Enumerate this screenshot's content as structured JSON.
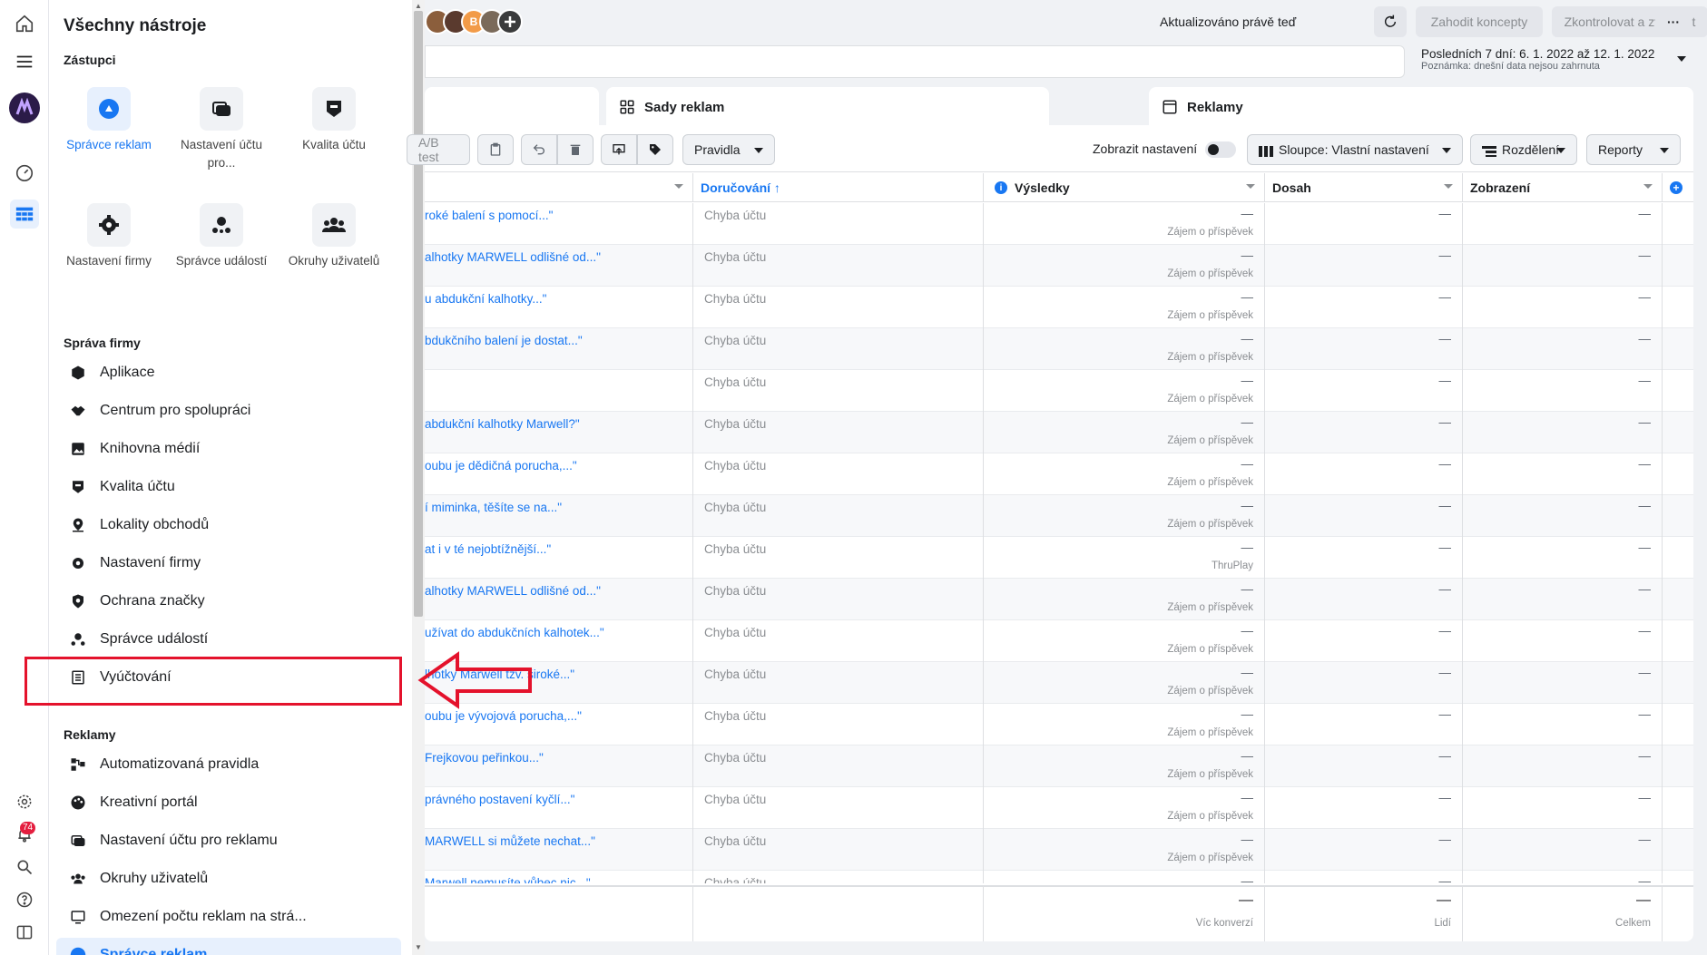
{
  "panel": {
    "title": "Všechny nástroje",
    "shortcuts_label": "Zástupci",
    "shortcuts": [
      {
        "label": "Správce reklam",
        "icon": "ads-manager-icon"
      },
      {
        "label": "Nastavení účtu pro...",
        "icon": "ad-account-settings-icon"
      },
      {
        "label": "Kvalita účtu",
        "icon": "account-quality-icon"
      },
      {
        "label": "Nastavení firmy",
        "icon": "gear-icon"
      },
      {
        "label": "Správce událostí",
        "icon": "events-manager-icon"
      },
      {
        "label": "Okruhy uživatelů",
        "icon": "audiences-icon"
      }
    ],
    "business_label": "Správa firmy",
    "business_items": [
      "Aplikace",
      "Centrum pro spolupráci",
      "Knihovna médií",
      "Kvalita účtu",
      "Lokality obchodů",
      "Nastavení firmy",
      "Ochrana značky",
      "Správce událostí",
      "Vyúčtování"
    ],
    "ads_label": "Reklamy",
    "ads_items": [
      "Automatizovaná pravidla",
      "Kreativní portál",
      "Nastavení účtu pro reklamu",
      "Okruhy uživatelů",
      "Omezení počtu reklam na strá...",
      "Správce reklam"
    ]
  },
  "rail": {
    "notification_count": "74"
  },
  "topbar": {
    "updated": "Aktualizováno právě teď",
    "discard": "Zahodit koncepty",
    "review": "Zkontrolovat a zveřejnit",
    "more": "···",
    "avatar_letter": "B"
  },
  "date": {
    "range": "Posledních 7 dní: 6. 1. 2022 až 12. 1. 2022",
    "note": "Poznámka: dnešní data nejsou zahrnuta"
  },
  "tabs": {
    "adsets": "Sady reklam",
    "ads": "Reklamy"
  },
  "toolbar": {
    "test": "A/B test",
    "rules": "Pravidla",
    "show_settings": "Zobrazit nastavení",
    "columns": "Sloupce: Vlastní nastavení",
    "breakdown": "Rozdělení",
    "reports": "Reporty"
  },
  "table": {
    "headers": {
      "delivery": "Doručování ↑",
      "results": "Výsledky",
      "reach": "Dosah",
      "impressions": "Zobrazení"
    },
    "rows": [
      {
        "name": "roké balení s pomocí...\"",
        "delivery": "Chyba účtu",
        "result": "—",
        "result_type": "Zájem o příspěvek",
        "reach": "—",
        "impressions": "—"
      },
      {
        "name": "alhotky MARWELL odlišné od...\"",
        "delivery": "Chyba účtu",
        "result": "—",
        "result_type": "Zájem o příspěvek",
        "reach": "—",
        "impressions": "—"
      },
      {
        "name": "u abdukční kalhotky...\"",
        "delivery": "Chyba účtu",
        "result": "—",
        "result_type": "Zájem o příspěvek",
        "reach": "—",
        "impressions": "—"
      },
      {
        "name": "bdukčního balení je dostat...\"",
        "delivery": "Chyba účtu",
        "result": "—",
        "result_type": "Zájem o příspěvek",
        "reach": "—",
        "impressions": "—"
      },
      {
        "name": "",
        "delivery": "Chyba účtu",
        "result": "—",
        "result_type": "Zájem o příspěvek",
        "reach": "—",
        "impressions": "—"
      },
      {
        "name": "abdukční kalhotky Marwell?\"",
        "delivery": "Chyba účtu",
        "result": "—",
        "result_type": "Zájem o příspěvek",
        "reach": "—",
        "impressions": "—"
      },
      {
        "name": "oubu je dědičná porucha,...\"",
        "delivery": "Chyba účtu",
        "result": "—",
        "result_type": "Zájem o příspěvek",
        "reach": "—",
        "impressions": "—"
      },
      {
        "name": "í miminka, těšíte se na...\"",
        "delivery": "Chyba účtu",
        "result": "—",
        "result_type": "Zájem o příspěvek",
        "reach": "—",
        "impressions": "—"
      },
      {
        "name": "at i v té nejobtížnější...\"",
        "delivery": "Chyba účtu",
        "result": "—",
        "result_type": "ThruPlay",
        "reach": "—",
        "impressions": "—"
      },
      {
        "name": "alhotky MARWELL odlišné od...\"",
        "delivery": "Chyba účtu",
        "result": "—",
        "result_type": "Zájem o příspěvek",
        "reach": "—",
        "impressions": "—"
      },
      {
        "name": "užívat do abdukčních kalhotek...\"",
        "delivery": "Chyba účtu",
        "result": "—",
        "result_type": "Zájem o příspěvek",
        "reach": "—",
        "impressions": "—"
      },
      {
        "name": "lhotky Marwell tzv. široké...\"",
        "delivery": "Chyba účtu",
        "result": "—",
        "result_type": "Zájem o příspěvek",
        "reach": "—",
        "impressions": "—"
      },
      {
        "name": "oubu je vývojová porucha,...\"",
        "delivery": "Chyba účtu",
        "result": "—",
        "result_type": "Zájem o příspěvek",
        "reach": "—",
        "impressions": "—"
      },
      {
        "name": " Frejkovou peřinkou...\"",
        "delivery": "Chyba účtu",
        "result": "—",
        "result_type": "Zájem o příspěvek",
        "reach": "—",
        "impressions": "—"
      },
      {
        "name": "právného postavení kyčlí...\"",
        "delivery": "Chyba účtu",
        "result": "—",
        "result_type": "Zájem o příspěvek",
        "reach": "—",
        "impressions": "—"
      },
      {
        "name": " MARWELL si můžete nechat...\"",
        "delivery": "Chyba účtu",
        "result": "—",
        "result_type": "Zájem o příspěvek",
        "reach": "—",
        "impressions": "—"
      },
      {
        "name": "Marwell nemusíte vůbec nic...\"",
        "delivery": "Chyba účtu",
        "result": "—",
        "result_type": "Zájem o příspěvek",
        "reach": "—",
        "impressions": "—"
      }
    ],
    "footer": {
      "results": "—",
      "results_label": "Víc konverzí",
      "reach": "—",
      "reach_label": "Lidí",
      "impressions": "—",
      "impressions_label": "Celkem"
    }
  },
  "colors": {
    "accent": "#1877f2",
    "highlight": "#e4122c"
  }
}
